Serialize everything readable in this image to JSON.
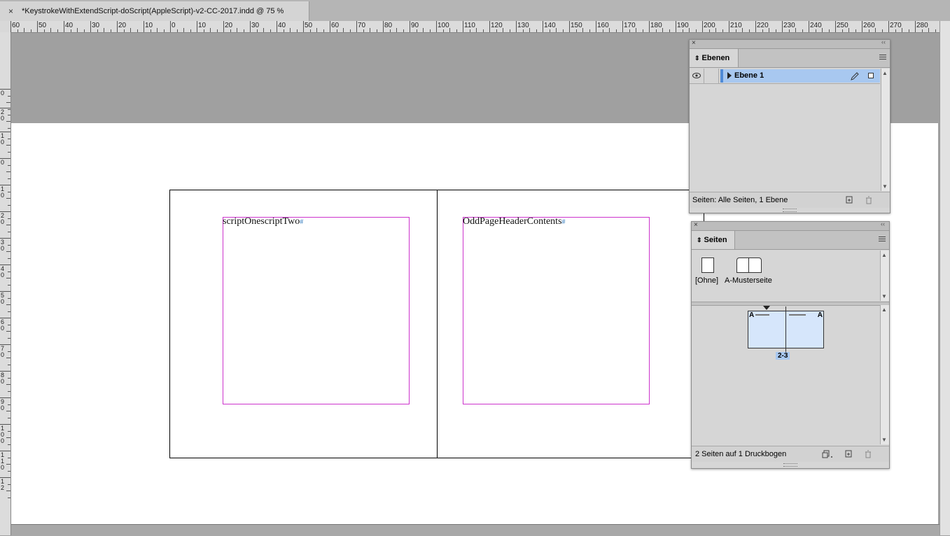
{
  "document_tab": {
    "close_glyph": "×",
    "title": "*KeystrokeWithExtendScript-doScript(AppleScript)-v2-CC-2017.indd @ 75 %"
  },
  "rulers": {
    "horizontal_labels": [
      "60",
      "50",
      "40",
      "30",
      "20",
      "10",
      "0",
      "10",
      "20",
      "30",
      "40",
      "50",
      "60",
      "70",
      "80",
      "90",
      "100",
      "110",
      "120",
      "130",
      "140",
      "150",
      "160",
      "170",
      "180",
      "190",
      "200",
      "210",
      "220",
      "230",
      "240",
      "250",
      "260",
      "270",
      "280"
    ],
    "vertical_labels": [
      "0",
      "20",
      "10",
      "0",
      "10",
      "20",
      "30",
      "40",
      "50",
      "60",
      "70",
      "80",
      "90",
      "100",
      "110",
      "12"
    ]
  },
  "page": {
    "left_frame_text": "scriptOnescriptTwo",
    "right_frame_text": "OddPageHeaderContents",
    "end_of_story_marker": "#"
  },
  "layers_panel": {
    "close_glyph": "×",
    "collapse_glyph": "‹‹",
    "tab_label": "Ebenen",
    "layer_name": "Ebene 1",
    "layer_color": "#4f8ad6",
    "status": "Seiten: Alle Seiten, 1 Ebene",
    "icons": [
      "eye-icon",
      "disclosure-triangle-icon",
      "pen-icon",
      "new-layer-icon",
      "trash-icon",
      "panel-menu-icon"
    ]
  },
  "pages_panel": {
    "close_glyph": "×",
    "collapse_glyph": "‹‹",
    "tab_label": "Seiten",
    "masters": [
      {
        "label": "[Ohne]"
      },
      {
        "label": "A-Musterseite"
      }
    ],
    "spread_left_prefix": "A",
    "spread_right_prefix": "A",
    "spread_label": "2-3",
    "status": "2 Seiten auf 1 Druckbogen",
    "icons": [
      "page-size-icon",
      "new-page-icon",
      "trash-icon",
      "panel-menu-icon"
    ]
  },
  "colors": {
    "frame_edge": "#cc33cc",
    "selection_blue": "#a8c8f0",
    "pasteboard": "#a0a0a0"
  }
}
